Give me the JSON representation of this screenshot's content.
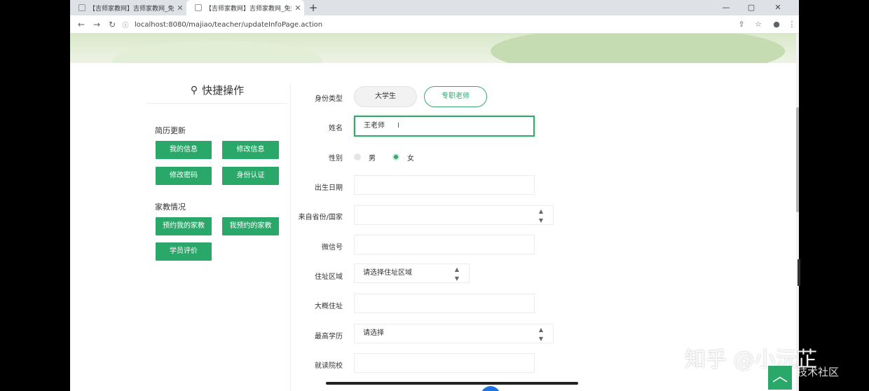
{
  "browser": {
    "tabs": [
      {
        "label": "【吉师家教网】吉师家教网_免费",
        "active": false
      },
      {
        "label": "【吉师家教网】吉师家教网_免费",
        "active": true
      }
    ],
    "new_tab": "+",
    "url": "localhost:8080/majiao/teacher/updateInfoPage.action",
    "window_controls": {
      "minimize": "—",
      "maximize": "▢",
      "close": "✕"
    }
  },
  "sidebar": {
    "title": "快捷操作",
    "section1": {
      "title": "简历更新",
      "buttons": [
        "我的信息",
        "修改信息",
        "修改密码",
        "身份认证"
      ]
    },
    "section2": {
      "title": "家教情况",
      "buttons": [
        "预约我的家教",
        "我预约的家教",
        "学员评价"
      ]
    }
  },
  "form": {
    "identity": {
      "label": "身份类型",
      "options": [
        "大学生",
        "专职老师"
      ],
      "selected": "专职老师"
    },
    "name": {
      "label": "姓名",
      "value": "王老师"
    },
    "gender": {
      "label": "性别",
      "options": [
        "男",
        "女"
      ],
      "selected": "女"
    },
    "birthdate": {
      "label": "出生日期",
      "value": ""
    },
    "origin": {
      "label": "来自省份/国家",
      "value": ""
    },
    "wechat": {
      "label": "微信号",
      "value": ""
    },
    "area": {
      "label": "住址区域",
      "value": "请选择住址区域"
    },
    "address": {
      "label": "大概住址",
      "value": ""
    },
    "education": {
      "label": "最高学历",
      "value": "请选择"
    },
    "school": {
      "label": "就读院校",
      "value": ""
    }
  },
  "watermark": {
    "main": "知乎 @小沅芷",
    "sub": "@稀土掘金技术社区"
  },
  "colors": {
    "accent": "#2aa86a",
    "page_bg": "#ffffff",
    "tab_strip": "#dee1e6"
  }
}
